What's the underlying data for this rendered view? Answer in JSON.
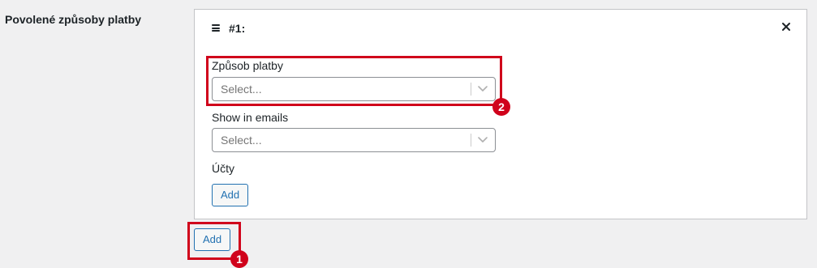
{
  "field": {
    "label": "Povolené způsoby platby"
  },
  "repeater": {
    "row_title": "#1:",
    "payment_method": {
      "label": "Způsob platby",
      "placeholder": "Select..."
    },
    "show_in_emails": {
      "label": "Show in emails",
      "placeholder": "Select..."
    },
    "accounts": {
      "label": "Účty",
      "add_label": "Add"
    }
  },
  "outer_add_label": "Add",
  "annotations": {
    "badge_1": "1",
    "badge_2": "2",
    "color": "#d0021b"
  },
  "icons": {
    "drag": "drag-handle-icon",
    "remove": "close-icon",
    "dropdown": "chevron-down-icon"
  }
}
